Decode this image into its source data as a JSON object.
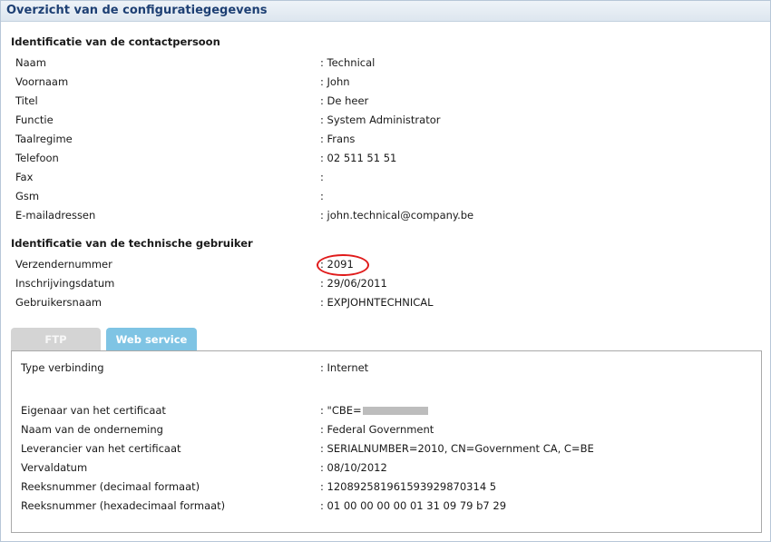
{
  "panel": {
    "title": "Overzicht van de configuratiegegevens"
  },
  "contact": {
    "title": "Identificatie van de contactpersoon",
    "rows": [
      {
        "label": "Naam",
        "value": ": Technical"
      },
      {
        "label": "Voornaam",
        "value": ": John"
      },
      {
        "label": "Titel",
        "value": ": De heer"
      },
      {
        "label": "Functie",
        "value": ": System Administrator"
      },
      {
        "label": "Taalregime",
        "value": ": Frans"
      },
      {
        "label": "Telefoon",
        "value": ": 02 511 51 51"
      },
      {
        "label": "Fax",
        "value": ":"
      },
      {
        "label": "Gsm",
        "value": ":"
      },
      {
        "label": "E-mailadressen",
        "value": ": john.technical@company.be"
      }
    ]
  },
  "technical": {
    "title": "Identificatie van de technische gebruiker",
    "rows": [
      {
        "label": "Verzendernummer",
        "value": ": 2091"
      },
      {
        "label": "Inschrijvingsdatum",
        "value": ": 29/06/2011"
      },
      {
        "label": "Gebruikersnaam",
        "value": ": EXPJOHNTECHNICAL"
      }
    ]
  },
  "tabs": [
    {
      "label": "FTP",
      "active": false
    },
    {
      "label": "Web service",
      "active": true
    }
  ],
  "webservice": {
    "rows": [
      {
        "label": "Type verbinding",
        "value": ": Internet"
      },
      {
        "label": "Eigenaar van het certificaat",
        "value": ": \"CBE="
      },
      {
        "label": "Naam van de onderneming",
        "value": ": Federal Government"
      },
      {
        "label": "Leverancier van het certificaat",
        "value": ": SERIALNUMBER=2010, CN=Government CA, C=BE"
      },
      {
        "label": "Vervaldatum",
        "value": ": 08/10/2012"
      },
      {
        "label": "Reeksnummer (decimaal formaat)",
        "value": ": 120892581961593929870314 5"
      },
      {
        "label": "Reeksnummer (hexadecimaal formaat)",
        "value": ": 01 00 00 00 00 01 31 09 79 b7 29"
      }
    ]
  },
  "colors": {
    "header_text": "#1d3f73",
    "active_tab": "#7fc4e4",
    "inactive_tab": "#d4d4d4",
    "highlight_circle": "#e01b1b"
  }
}
